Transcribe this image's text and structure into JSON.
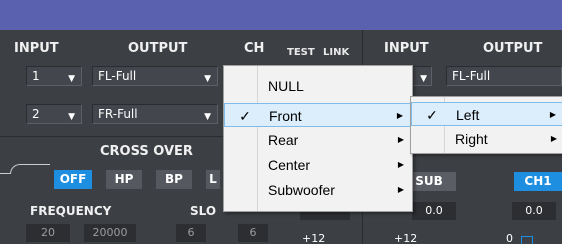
{
  "left": {
    "headers": {
      "input": "INPUT",
      "output": "OUTPUT",
      "ch": "CH",
      "test": "TEST",
      "link": "LINK"
    },
    "rows": [
      {
        "input": "1",
        "output": "FL-Full"
      },
      {
        "input": "2",
        "output": "FR-Full"
      }
    ],
    "crossover": {
      "title": "CROSS OVER",
      "buttons": [
        "OFF",
        "HP",
        "BP",
        "L"
      ],
      "active": "OFF",
      "frequency_label": "FREQUENCY",
      "slope_label": "SLO",
      "values": [
        "20",
        "20000",
        "6",
        "6"
      ]
    }
  },
  "right": {
    "headers": {
      "input": "INPUT",
      "output": "OUTPUT"
    },
    "rows": [
      {
        "output": "FL-Full"
      }
    ],
    "sub_button": "SUB",
    "ch1_button": "CH1",
    "values": [
      "0.0",
      "0.0"
    ],
    "gains": [
      "+12",
      "+12",
      "0"
    ]
  },
  "menu": {
    "items": [
      {
        "label": "NULL",
        "checked": false,
        "submenu": false
      },
      {
        "label": "Front",
        "checked": true,
        "submenu": true
      },
      {
        "label": "Rear",
        "checked": false,
        "submenu": true
      },
      {
        "label": "Center",
        "checked": false,
        "submenu": true
      },
      {
        "label": "Subwoofer",
        "checked": false,
        "submenu": true
      }
    ]
  },
  "submenu": {
    "items": [
      {
        "label": "Left",
        "checked": true,
        "submenu": true
      },
      {
        "label": "Right",
        "checked": false,
        "submenu": true
      }
    ]
  },
  "glyphs": {
    "check": "✓",
    "caret": "▼",
    "arrow": "▶"
  },
  "colors": {
    "accent": "#1e8fe0",
    "menu_bg": "#f2f2f2",
    "highlight": "#dceefb",
    "topbar": "#5a62b0"
  }
}
